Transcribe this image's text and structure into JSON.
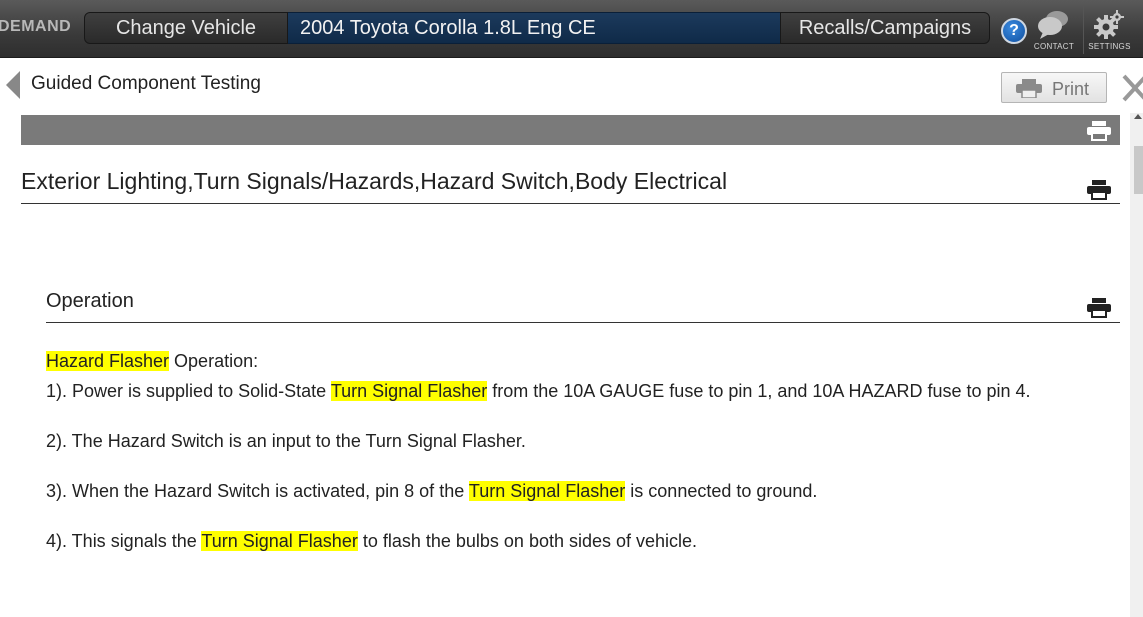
{
  "header": {
    "brand": "DEMAND",
    "change_vehicle_label": "Change Vehicle",
    "vehicle": "2004 Toyota Corolla 1.8L Eng CE",
    "recalls_label": "Recalls/Campaigns",
    "help_label": "?",
    "contact_label": "CONTACT",
    "settings_label": "SETTINGS"
  },
  "subheader": {
    "title": "Guided Component Testing",
    "print_label": "Print"
  },
  "content": {
    "section_heading": "Exterior Lighting,Turn Signals/Hazards,Hazard Switch,Body Electrical",
    "subsection_heading": "Operation",
    "intro": {
      "highlight": "Hazard Flasher",
      "rest": " Operation:"
    },
    "step1": {
      "before": "1). Power is supplied to Solid-State ",
      "highlight": "Turn Signal Flasher",
      "after": " from the 10A GAUGE fuse to pin 1, and 10A HAZARD fuse to pin 4."
    },
    "step2": {
      "text": "2). The Hazard Switch is an input to the Turn Signal Flasher."
    },
    "step3": {
      "before": "3). When the Hazard Switch is activated, pin 8 of the ",
      "highlight": "Turn Signal Flasher",
      "after": " is connected to ground."
    },
    "step4": {
      "before": "4). This signals the ",
      "highlight": "Turn Signal Flasher",
      "after": " to flash the bulbs on both sides of vehicle."
    }
  },
  "colors": {
    "highlight": "#ffff00",
    "vehicle_field": "#163554",
    "topbar": "#3a3a3a",
    "section_bar": "#7a7a7a"
  },
  "icons": [
    "back-arrow-icon",
    "help-icon",
    "chat-bubbles-icon",
    "gears-icon",
    "printer-icon",
    "close-icon"
  ]
}
